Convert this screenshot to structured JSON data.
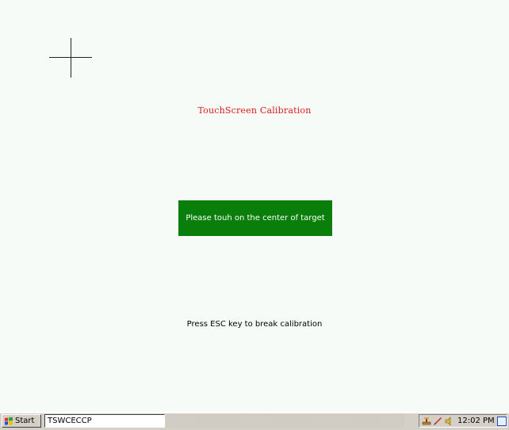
{
  "calibration": {
    "title": "TouchScreen Calibration",
    "instruction": "Please touh on the center of target",
    "esc_hint": "Press ESC key to break calibration"
  },
  "taskbar": {
    "start_label": "Start",
    "task_label": "TSWCECCP",
    "clock": "12:02 PM"
  },
  "icons": {
    "crosshair": "crosshair-target-icon",
    "start": "windows-flag-icon",
    "tray": [
      "network-icon",
      "pen-icon",
      "speaker-icon"
    ],
    "desktop": "show-desktop-icon"
  },
  "colors": {
    "background": "#f7fbf7",
    "title": "#e01818",
    "instruction_bg": "#0a7e0a",
    "taskbar": "#d4d0c8"
  }
}
